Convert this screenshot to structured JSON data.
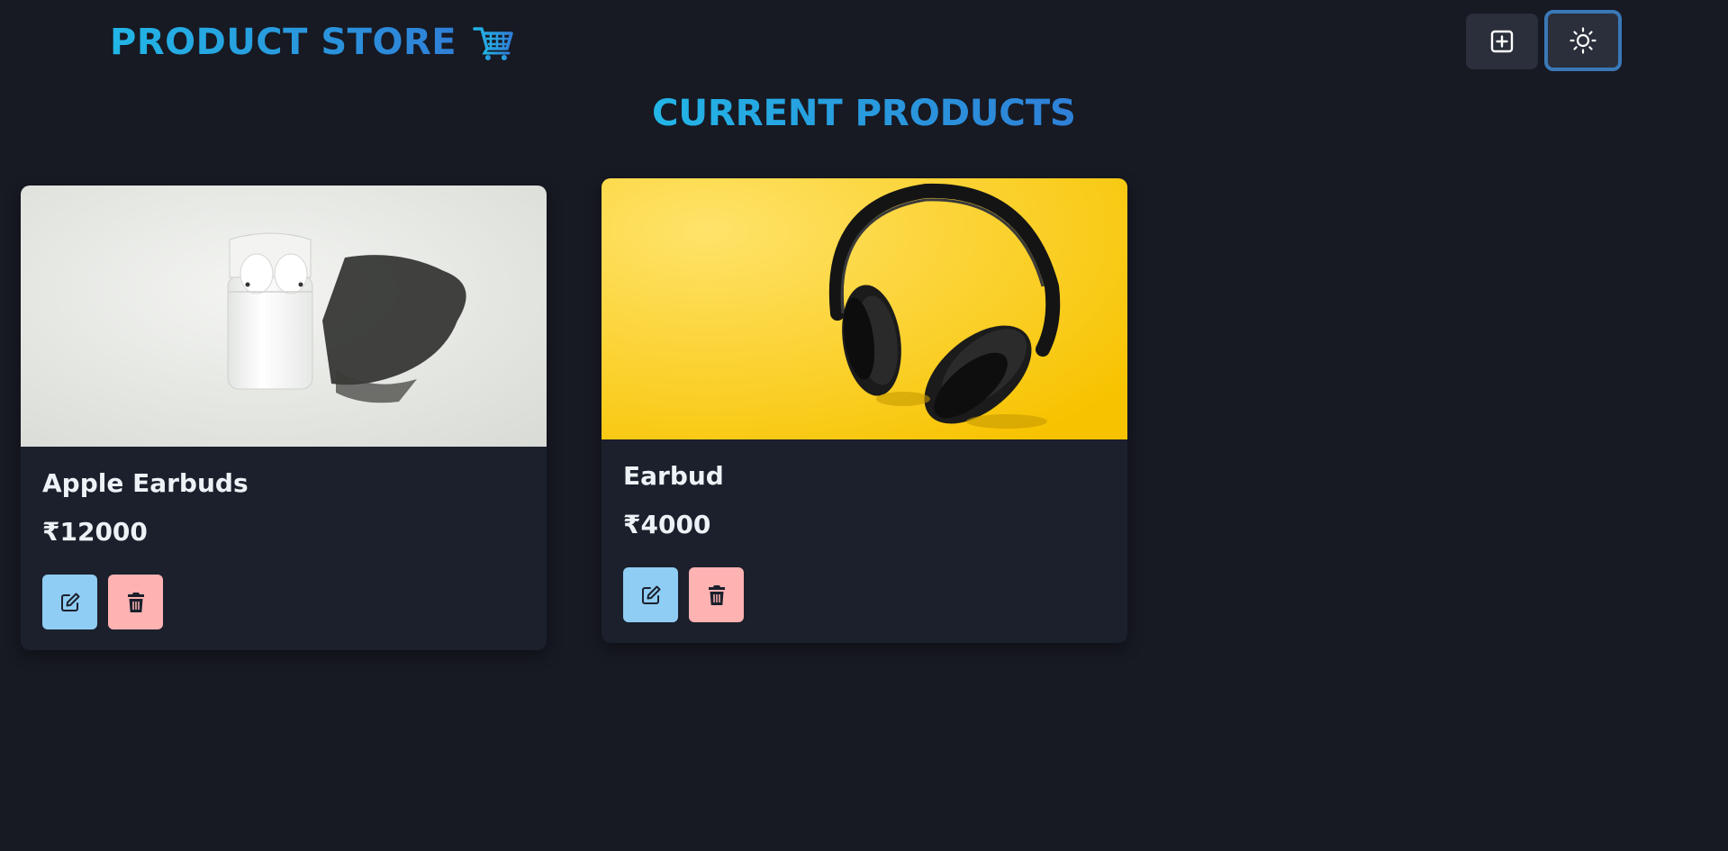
{
  "header": {
    "brand_title": "PRODUCT STORE",
    "brand_icon": "shopping-cart-icon",
    "add_button_icon": "plus-square-icon",
    "theme_button_icon": "sun-icon"
  },
  "main": {
    "section_title": "CURRENT PRODUCTS",
    "products": [
      {
        "name": "Apple Earbuds",
        "price": "₹12000",
        "image": "airpods-case-photo",
        "edit_icon": "edit-icon",
        "delete_icon": "trash-icon"
      },
      {
        "name": "Earbud",
        "price": "₹4000",
        "image": "headphones-on-yellow-photo",
        "edit_icon": "edit-icon",
        "delete_icon": "trash-icon"
      }
    ]
  },
  "colors": {
    "background": "#171923",
    "card": "#1b202c",
    "accent_start": "#22b6e6",
    "accent_end": "#2f7fd6",
    "edit_button": "#90cdf4",
    "delete_button": "#feb2b2",
    "header_button": "#2a2f3b",
    "theme_button_border": "#3a78b6"
  }
}
